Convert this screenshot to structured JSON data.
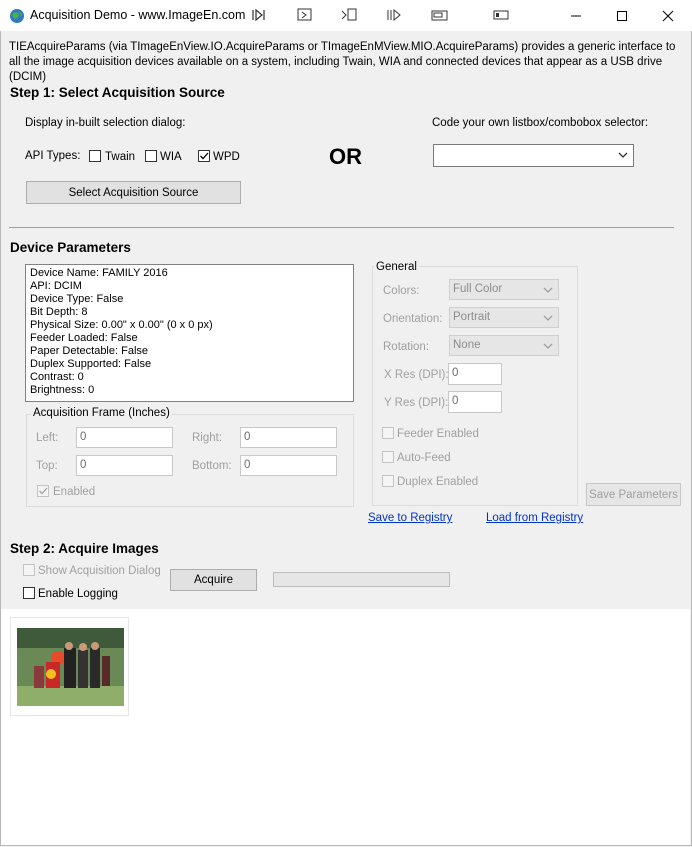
{
  "window": {
    "title": "Acquisition Demo - www.ImageEn.com"
  },
  "intro": "TIEAcquireParams (via TImageEnView.IO.AcquireParams or TImageEnMView.MIO.AcquireParams) provides a generic interface to all the image acquisition devices available on a system, including Twain, WIA and connected devices that appear as a USB drive (DCIM)",
  "step1": {
    "heading": "Step 1: Select Acquisition Source",
    "builtin_label": "Display in-built selection dialog:",
    "api_types_label": "API Types:",
    "twain": "Twain",
    "wia": "WIA",
    "wpd": "WPD",
    "or_text": "OR",
    "custom_label": "Code your own listbox/combobox selector:",
    "select_button": "Select Acquisition Source"
  },
  "device": {
    "heading": "Device Parameters",
    "info": [
      "Device Name: FAMILY 2016",
      "API: DCIM",
      "Device Type: False",
      "Bit Depth: 8",
      "Physical Size: 0.00\" x 0.00\" (0 x 0 px)",
      "Feeder Loaded: False",
      "Paper Detectable: False",
      "Duplex Supported: False",
      "Contrast: 0",
      "Brightness: 0"
    ],
    "frame": {
      "legend": "Acquisition Frame (Inches)",
      "left_label": "Left:",
      "left_value": "0",
      "right_label": "Right:",
      "right_value": "0",
      "top_label": "Top:",
      "top_value": "0",
      "bottom_label": "Bottom:",
      "bottom_value": "0",
      "enabled_label": "Enabled"
    },
    "general": {
      "legend": "General",
      "colors_label": "Colors:",
      "colors_value": "Full Color",
      "orientation_label": "Orientation:",
      "orientation_value": "Portrait",
      "rotation_label": "Rotation:",
      "rotation_value": "None",
      "xres_label": "X Res (DPI):",
      "xres_value": "0",
      "yres_label": "Y Res (DPI):",
      "yres_value": "0",
      "feeder_label": "Feeder Enabled",
      "autofeed_label": "Auto-Feed",
      "duplex_label": "Duplex Enabled"
    },
    "save_params": "Save Parameters",
    "save_registry": "Save to Registry",
    "load_registry": "Load from Registry"
  },
  "step2": {
    "heading": "Step 2: Acquire Images",
    "show_dialog": "Show Acquisition Dialog",
    "enable_logging": "Enable Logging",
    "acquire_button": "Acquire"
  }
}
